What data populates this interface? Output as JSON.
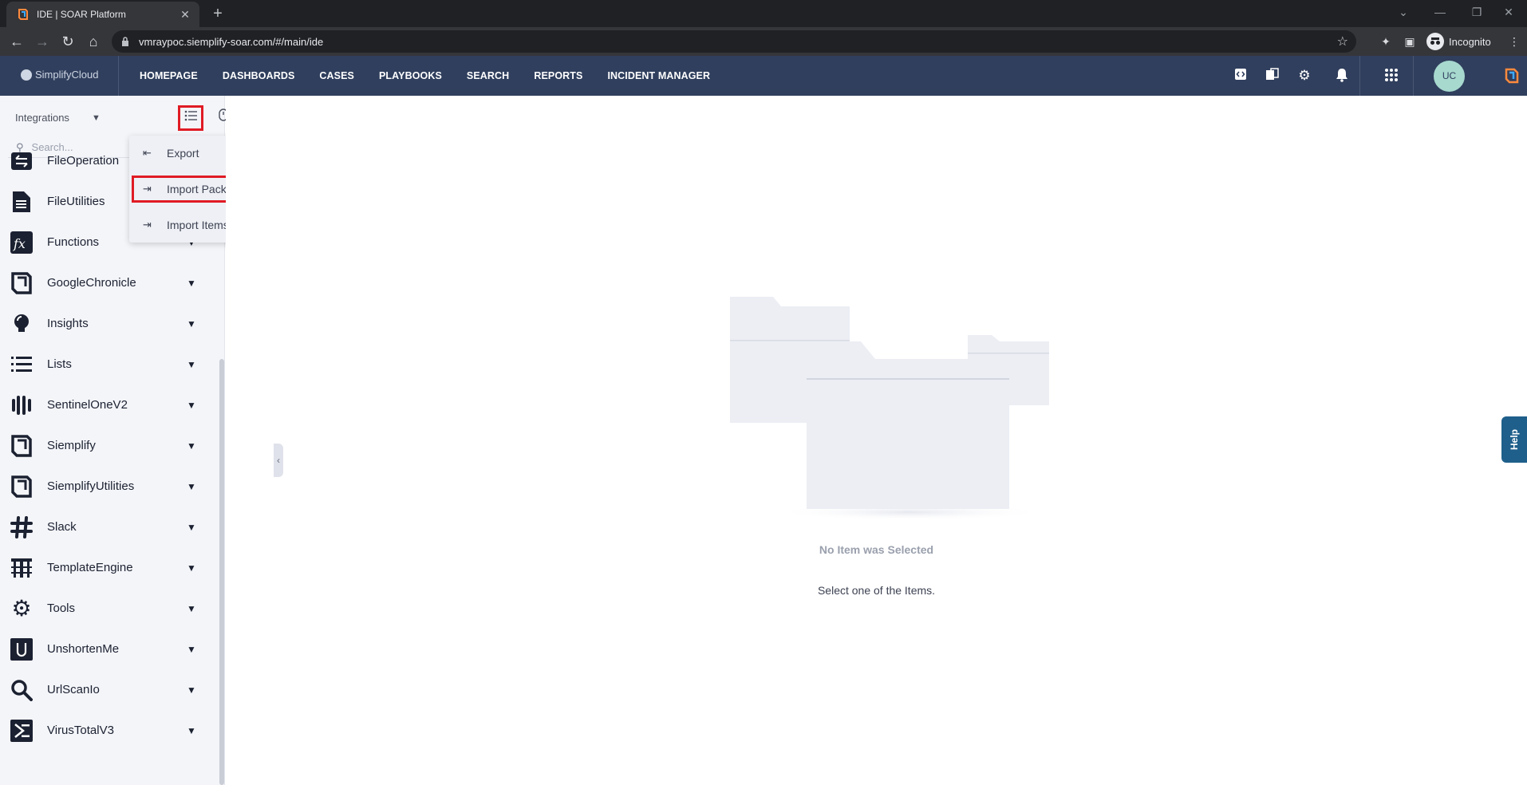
{
  "browser": {
    "tab_title": "IDE | SOAR Platform",
    "tab_close": "✕",
    "new_tab": "+",
    "url": "vmraypoc.siemplify-soar.com/#/main/ide",
    "profile_label": "Incognito"
  },
  "app": {
    "logo_text": "SimplifyCloud",
    "nav": [
      "HOMEPAGE",
      "DASHBOARDS",
      "CASES",
      "PLAYBOOKS",
      "SEARCH",
      "REPORTS",
      "INCIDENT MANAGER"
    ],
    "avatar_initials": "UC"
  },
  "sidebar": {
    "selector_label": "Integrations",
    "search_placeholder": "Search...",
    "items": [
      {
        "label": "FileOperation",
        "icon": "file-transfer-icon"
      },
      {
        "label": "FileUtilities",
        "icon": "document-icon"
      },
      {
        "label": "Functions",
        "icon": "fx-icon"
      },
      {
        "label": "GoogleChronicle",
        "icon": "chronicle-icon"
      },
      {
        "label": "Insights",
        "icon": "lightbulb-icon"
      },
      {
        "label": "Lists",
        "icon": "list-icon"
      },
      {
        "label": "SentinelOneV2",
        "icon": "sentinelone-icon"
      },
      {
        "label": "Siemplify",
        "icon": "siemplify-icon"
      },
      {
        "label": "SiemplifyUtilities",
        "icon": "siemplify-icon"
      },
      {
        "label": "Slack",
        "icon": "hash-icon"
      },
      {
        "label": "TemplateEngine",
        "icon": "template-icon"
      },
      {
        "label": "Tools",
        "icon": "gear-icon"
      },
      {
        "label": "UnshortenMe",
        "icon": "u-icon"
      },
      {
        "label": "UrlScanIo",
        "icon": "magnifier-icon"
      },
      {
        "label": "VirusTotalV3",
        "icon": "virustotal-icon"
      }
    ]
  },
  "menu": {
    "items": [
      "Export",
      "Import Package",
      "Import Items"
    ]
  },
  "main": {
    "empty_title": "No Item was Selected",
    "empty_subtitle": "Select one of the Items."
  },
  "help_label": "Help",
  "colors": {
    "header_bg": "#303f5d",
    "highlight": "#e01b24",
    "help_bg": "#1f5f8b"
  }
}
